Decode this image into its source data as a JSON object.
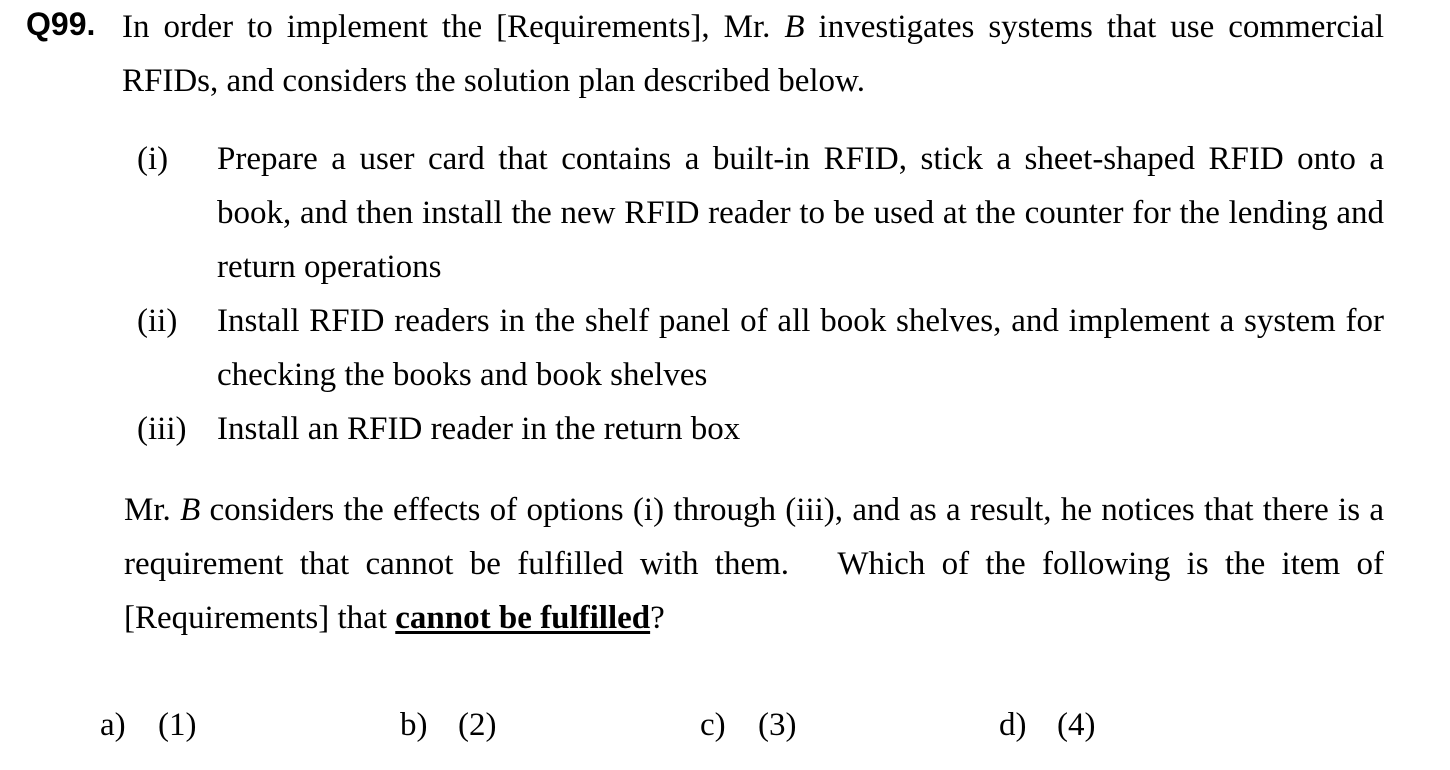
{
  "question": {
    "number": "Q99.",
    "intro_before_var": "In order to implement the [Requirements], Mr. ",
    "intro_var": "B",
    "intro_after_var": " investigates systems that use commercial RFIDs, and considers the solution plan described below."
  },
  "plan_items": [
    {
      "label": "(i)",
      "text": "Prepare a user card that contains a built-in RFID, stick a sheet-shaped RFID onto a book, and then install the new RFID reader to be used at the counter for the lending and return operations"
    },
    {
      "label": "(ii)",
      "text": "Install RFID readers in the shelf panel of all book shelves, and implement a system for checking the books and book shelves"
    },
    {
      "label": "(iii)",
      "text": "Install an RFID reader in the return box"
    }
  ],
  "conclusion": {
    "prefix": "Mr. ",
    "var": "B",
    "middle": " considers the effects of options (i) through (iii), and as a result, he notices that there is a requirement that cannot be fulfilled with them.   Which of the following is the item of [Requirements] that ",
    "emphasis": "cannot be fulfilled",
    "suffix": "?"
  },
  "options": [
    {
      "letter": "a)",
      "value": "(1)"
    },
    {
      "letter": "b)",
      "value": "(2)"
    },
    {
      "letter": "c)",
      "value": "(3)"
    },
    {
      "letter": "d)",
      "value": "(4)"
    }
  ]
}
